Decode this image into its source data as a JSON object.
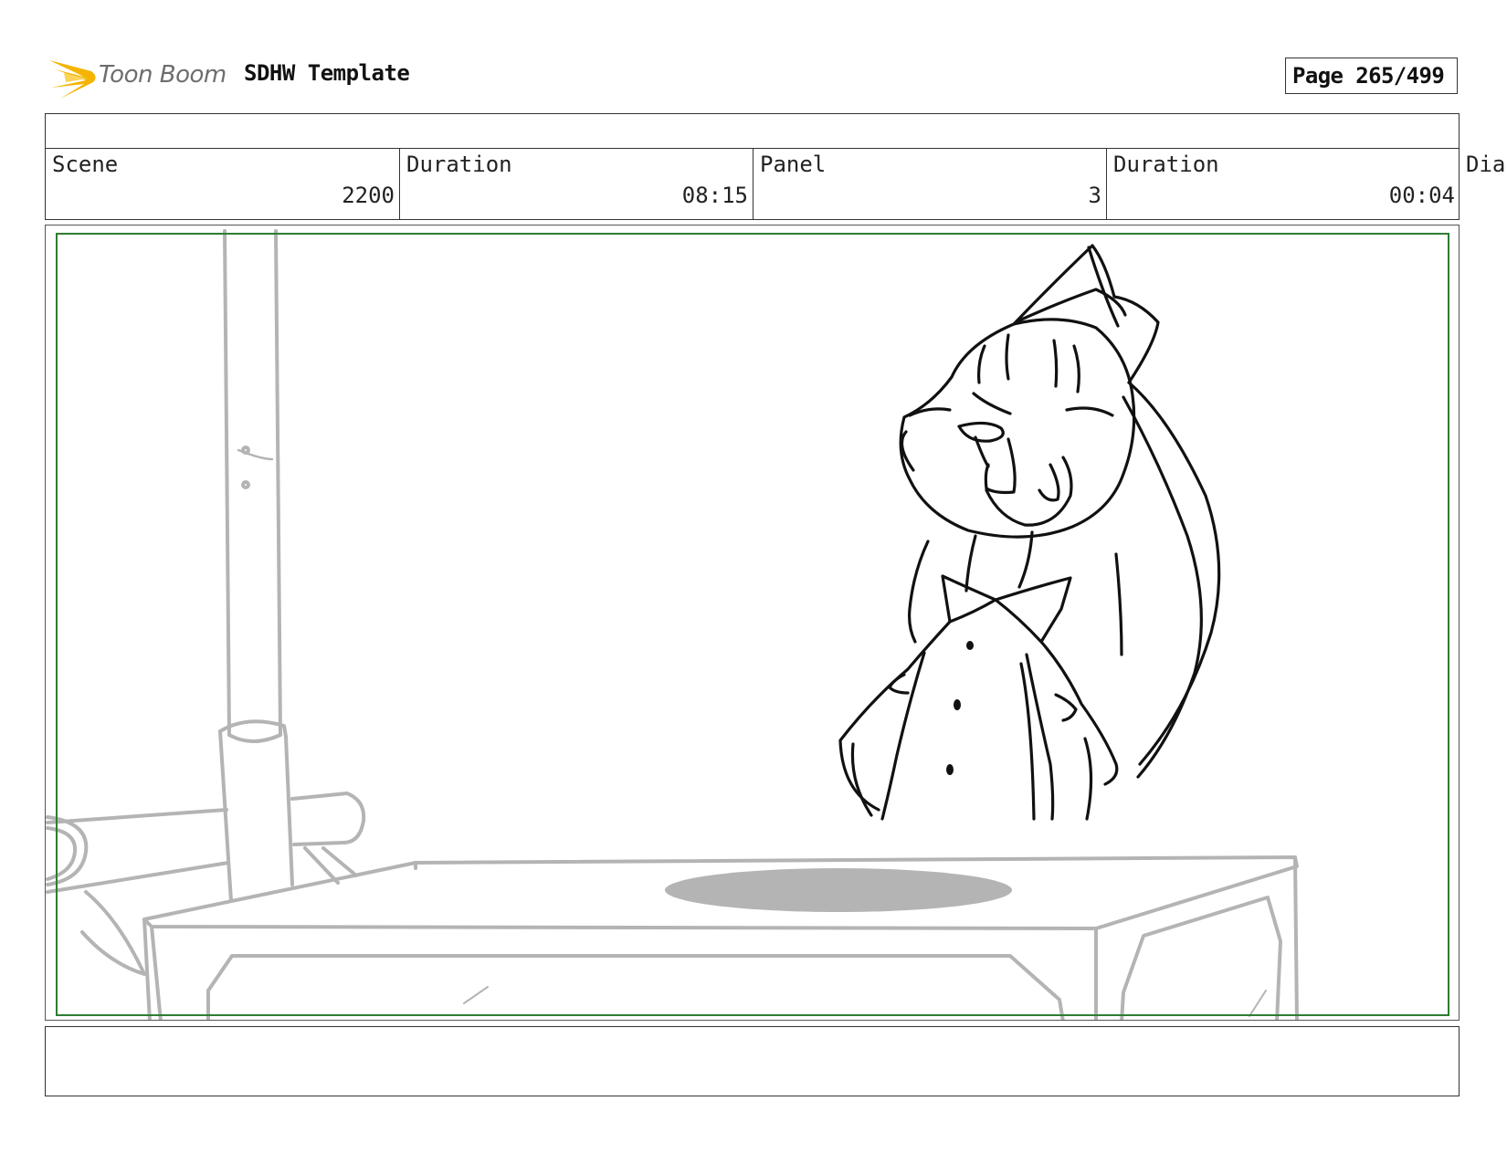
{
  "header": {
    "logo_text": "Toon Boom",
    "template_name": "SDHW Template",
    "page_label": "Page 265/499"
  },
  "info": {
    "scene_label": "Scene",
    "scene_value": "2200",
    "scene_duration_label": "Duration",
    "scene_duration_value": "08:15",
    "panel_label": "Panel",
    "panel_value": "3",
    "panel_duration_label": "Duration",
    "panel_duration_value": "00:04",
    "dialogue_label": "Dia"
  },
  "colors": {
    "safe_frame": "#2e7d32",
    "logo_flame": "#f4b400",
    "sketch_gray": "#b4b4b4",
    "sketch_ink": "#111111"
  }
}
